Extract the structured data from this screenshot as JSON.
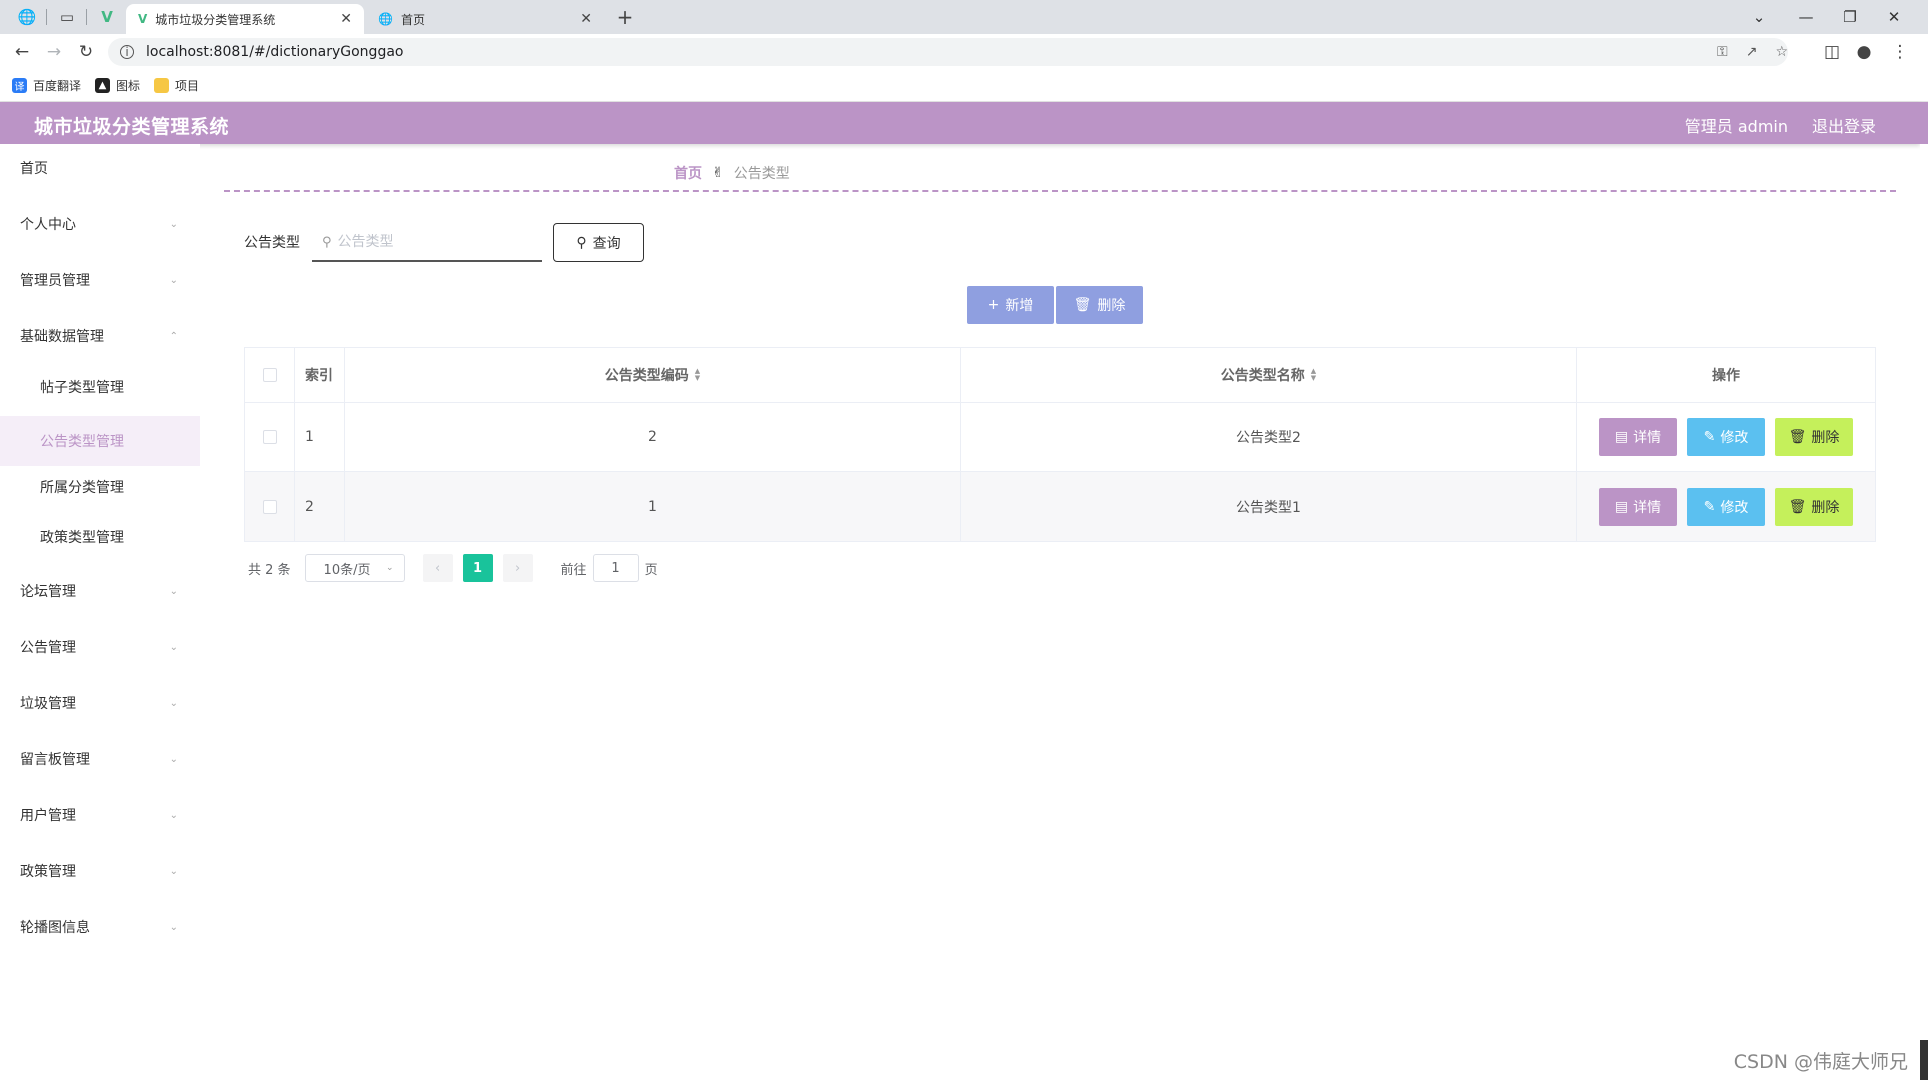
{
  "browser": {
    "tabs": [
      {
        "title": "城市垃圾分类管理系统",
        "active": true
      },
      {
        "title": "首页",
        "active": false
      }
    ],
    "url": "localhost:8081/#/dictionaryGonggao",
    "bookmarks": [
      "百度翻译",
      "图标",
      "项目"
    ]
  },
  "app": {
    "title": "城市垃圾分类管理系统",
    "user": "管理员 admin",
    "logout": "退出登录",
    "accent_color": "#bb94c6"
  },
  "sidebar": {
    "items": [
      {
        "label": "首页"
      },
      {
        "label": "个人中心"
      },
      {
        "label": "管理员管理"
      },
      {
        "label": "基础数据管理"
      },
      {
        "label": "帖子类型管理"
      },
      {
        "label": "公告类型管理"
      },
      {
        "label": "所属分类管理"
      },
      {
        "label": "政策类型管理"
      },
      {
        "label": "论坛管理"
      },
      {
        "label": "公告管理"
      },
      {
        "label": "垃圾管理"
      },
      {
        "label": "留言板管理"
      },
      {
        "label": "用户管理"
      },
      {
        "label": "政策管理"
      },
      {
        "label": "轮播图信息"
      }
    ],
    "active_item": "公告类型管理"
  },
  "breadcrumb": {
    "home": "首页",
    "current": "公告类型"
  },
  "search": {
    "label": "公告类型",
    "placeholder": "公告类型",
    "value": "",
    "query_button": "查询"
  },
  "actions": {
    "add": "新增",
    "delete": "删除"
  },
  "table": {
    "headers": {
      "index": "索引",
      "code": "公告类型编码",
      "name": "公告类型名称",
      "ops": "操作"
    },
    "rows": [
      {
        "index": "1",
        "code": "2",
        "name": "公告类型2"
      },
      {
        "index": "2",
        "code": "1",
        "name": "公告类型1"
      }
    ],
    "row_buttons": {
      "detail": "详情",
      "edit": "修改",
      "delete": "删除"
    }
  },
  "pagination": {
    "total": "共 2 条",
    "page_size": "10条/页",
    "current_page": "1",
    "goto_prefix": "前往",
    "goto_value": "1",
    "goto_suffix": "页"
  },
  "watermark": "CSDN @伟庭大师兄"
}
